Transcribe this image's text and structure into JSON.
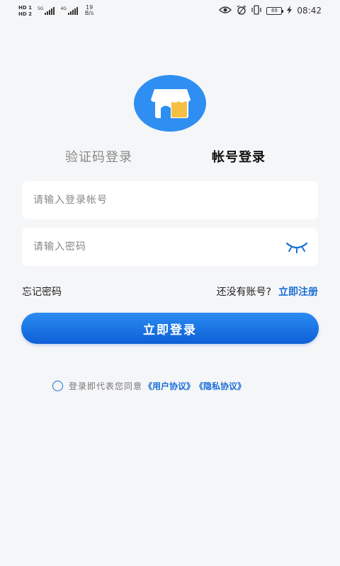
{
  "status_bar": {
    "hd1": "HD 1",
    "hd2": "HD 2",
    "net1": "5G",
    "net2": "4G",
    "speed_value": "19",
    "speed_unit": "B/s",
    "battery": "69",
    "time": "08:42",
    "icons": [
      "eye-icon",
      "alarm-icon",
      "vibrate-icon",
      "battery-icon",
      "charging-icon"
    ]
  },
  "logo": {
    "icon": "shop-icon",
    "colors": {
      "bg": "#2f8ef2",
      "awning": "#ffffff",
      "door": "#f5c042"
    }
  },
  "tabs": {
    "sms_label": "验证码登录",
    "account_label": "帐号登录",
    "active": "account"
  },
  "form": {
    "account_placeholder": "请输入登录帐号",
    "account_value": "",
    "password_placeholder": "请输入密码",
    "password_value": "",
    "password_toggle_icon": "eye-closed-icon"
  },
  "links": {
    "forgot_password": "忘记密码",
    "no_account": "还没有账号?",
    "register": "立即注册"
  },
  "login_button": "立即登录",
  "agreement": {
    "prefix": "登录即代表您同意",
    "user_agreement": "《用户协议》",
    "privacy_policy": "《隐私协议》",
    "checked": false
  },
  "colors": {
    "accent": "#1a6ed8",
    "background": "#f5f6f8"
  }
}
